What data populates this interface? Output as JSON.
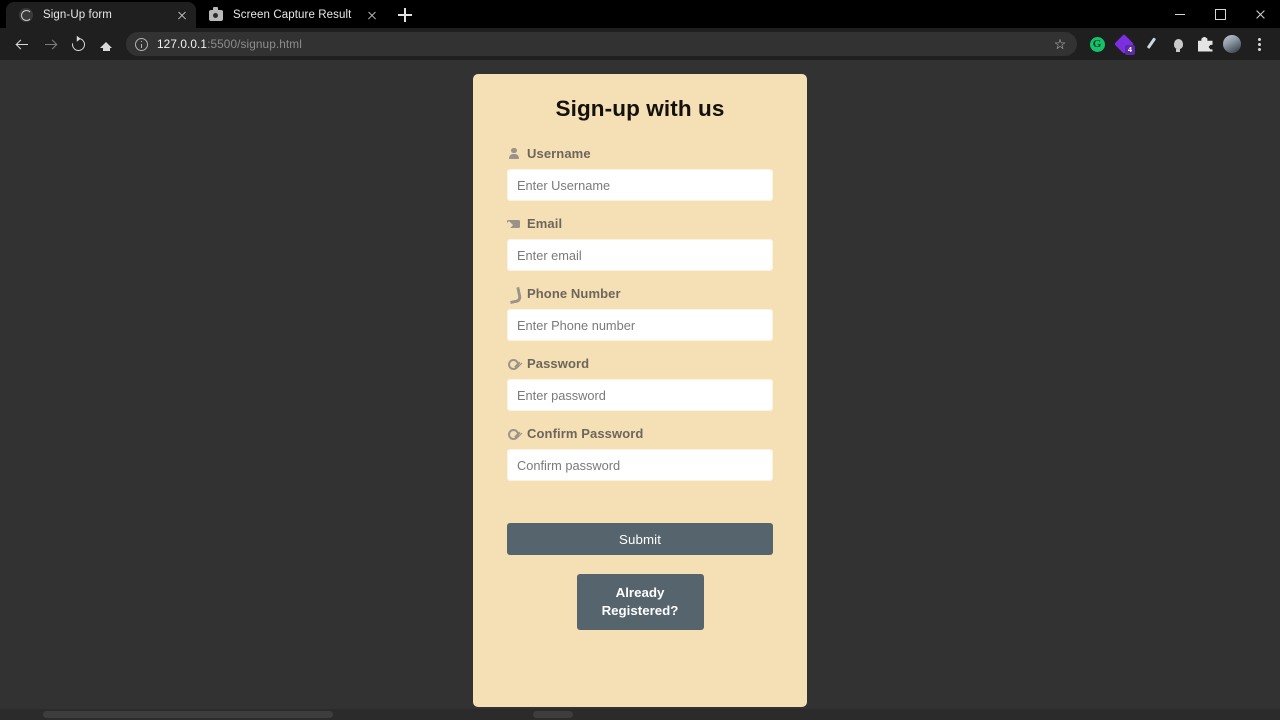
{
  "window": {
    "controls": [
      {
        "name": "minimize",
        "label": "Minimize"
      },
      {
        "name": "maximize",
        "label": "Maximize"
      },
      {
        "name": "close",
        "label": "Close"
      }
    ]
  },
  "tabs": [
    {
      "title": "Sign-Up form",
      "favicon": "globe-icon",
      "active": true,
      "close_label": "Close tab"
    },
    {
      "title": "Screen Capture Result",
      "favicon": "camera-icon",
      "active": false,
      "close_label": "Close tab"
    }
  ],
  "newtab": {
    "label": "New tab"
  },
  "toolbar": {
    "back": "Back",
    "forward": "Forward",
    "reload": "Reload",
    "home": "Home",
    "bookmark_star": "☆",
    "url": {
      "host": "127.0.0.1",
      "path": ":5500/signup.html",
      "full": "127.0.0.1:5500/signup.html"
    },
    "extensions": [
      {
        "name": "grammarly-extension-icon",
        "glyph": "G",
        "badge": ""
      },
      {
        "name": "purple-extension-icon",
        "glyph": "",
        "badge": "4"
      },
      {
        "name": "eyedropper-extension-icon",
        "glyph": "",
        "badge": ""
      },
      {
        "name": "lightbulb-extension-icon",
        "glyph": "",
        "badge": ""
      },
      {
        "name": "extensions-puzzle-icon",
        "glyph": "",
        "badge": ""
      }
    ],
    "profile": "Profile",
    "menu": "Customize and control"
  },
  "page": {
    "background_color": "#323232",
    "card": {
      "background_color": "#f5dfb4",
      "title": "Sign-up with us",
      "fields": [
        {
          "id": "username",
          "icon": "user-icon",
          "label": "Username",
          "placeholder": "Enter Username",
          "value": "",
          "type": "text"
        },
        {
          "id": "email",
          "icon": "envelope-icon",
          "label": "Email",
          "placeholder": "Enter email",
          "value": "",
          "type": "email"
        },
        {
          "id": "phone",
          "icon": "phone-icon",
          "label": "Phone Number",
          "placeholder": "Enter Phone number",
          "value": "",
          "type": "tel"
        },
        {
          "id": "password",
          "icon": "key-icon",
          "label": "Password",
          "placeholder": "Enter password",
          "value": "",
          "type": "password"
        },
        {
          "id": "confirm-password",
          "icon": "key-icon",
          "label": "Confirm Password",
          "placeholder": "Confirm password",
          "value": "",
          "type": "password"
        }
      ],
      "submit_label": "Submit",
      "already_registered_label": "Already Registered?",
      "button_color": "#56646e"
    }
  }
}
